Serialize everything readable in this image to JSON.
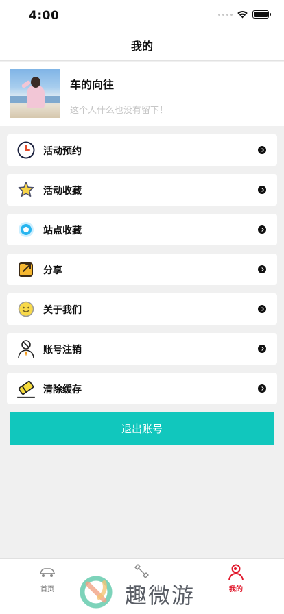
{
  "status_bar": {
    "time": "4:00"
  },
  "nav": {
    "title": "我的"
  },
  "profile": {
    "name": "车的向往",
    "bio": "这个人什么也没有留下！"
  },
  "menu": [
    {
      "label": "活动预约",
      "icon": "clock-icon"
    },
    {
      "label": "活动收藏",
      "icon": "star-icon"
    },
    {
      "label": "站点收藏",
      "icon": "location-icon"
    },
    {
      "label": "分享",
      "icon": "share-icon"
    },
    {
      "label": "关于我们",
      "icon": "smiley-icon"
    },
    {
      "label": "账号注销",
      "icon": "account-cancel-icon"
    },
    {
      "label": "清除缓存",
      "icon": "eraser-icon"
    }
  ],
  "logout": {
    "label": "退出账号"
  },
  "tabs": [
    {
      "label": "首页",
      "icon": "car-icon"
    },
    {
      "label": "",
      "icon": "wrench-icon"
    },
    {
      "label": "我的",
      "icon": "person-icon"
    }
  ],
  "watermark": {
    "text": "趣微游"
  },
  "colors": {
    "accent": "#11c7bd",
    "tab_active": "#e1162a"
  }
}
